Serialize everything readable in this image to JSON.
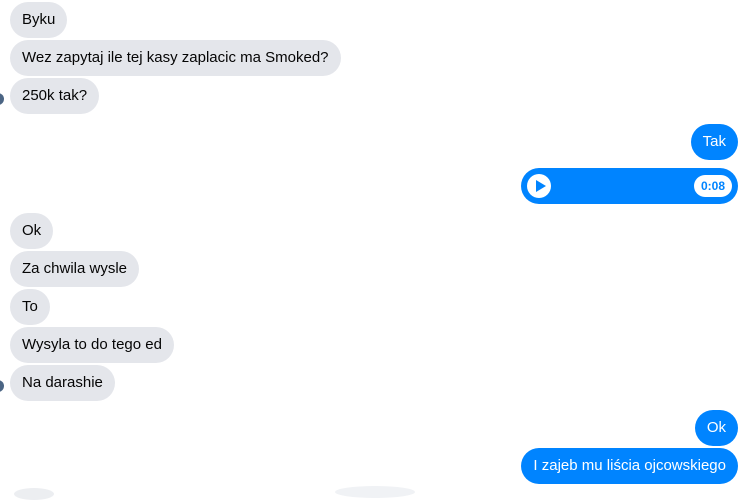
{
  "conversation": {
    "group1": [
      "Byku",
      "Wez zapytaj ile tej kasy zaplacic ma Smoked?",
      "250k tak?"
    ],
    "reply1": "Tak",
    "voice_message": {
      "duration": "0:08",
      "icon": "play-icon",
      "color": "#0084ff"
    },
    "group2": [
      "Ok",
      "Za chwila wysle",
      "To",
      "Wysyla to do tego ed",
      "Na darashie"
    ],
    "reply2": [
      "Ok",
      "I zajeb mu liścia ojcowskiego"
    ]
  },
  "colors": {
    "incoming_bubble": "#e4e6eb",
    "outgoing_bubble": "#0084ff"
  }
}
